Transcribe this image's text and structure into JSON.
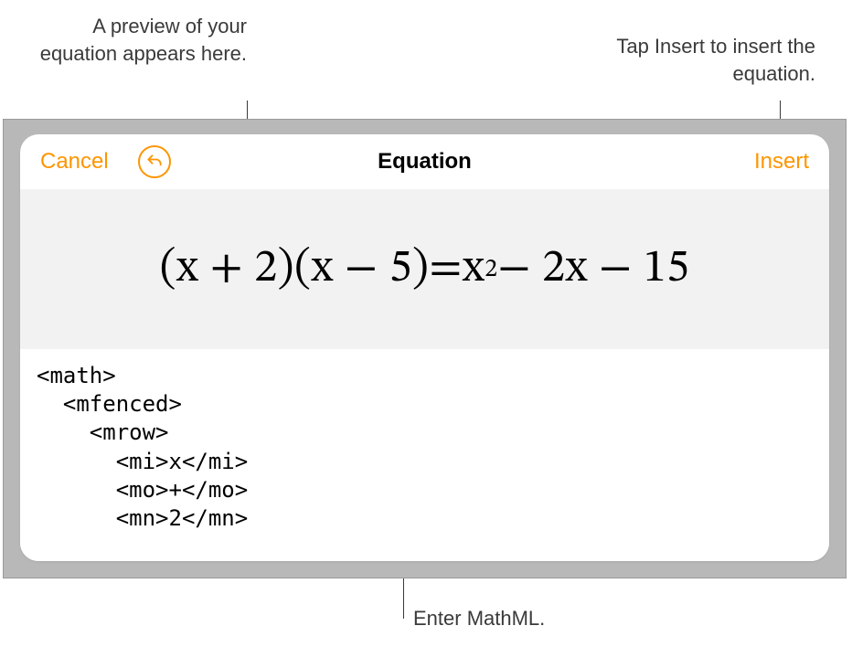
{
  "callouts": {
    "previewHint": "A preview of your equation appears here.",
    "insertHint": "Tap Insert to insert the equation.",
    "mathmlHint": "Enter MathML."
  },
  "header": {
    "cancel": "Cancel",
    "title": "Equation",
    "insert": "Insert"
  },
  "preview": {
    "lhs1": "(x + 2)",
    "lhs2": "(x − 5)",
    "eq": " = ",
    "rhsBase": "x",
    "rhsExp": "2",
    "rhsTail": " − 2x − 15"
  },
  "code": "<math>\n  <mfenced>\n    <mrow>\n      <mi>x</mi>\n      <mo>+</mo>\n      <mn>2</mn>"
}
